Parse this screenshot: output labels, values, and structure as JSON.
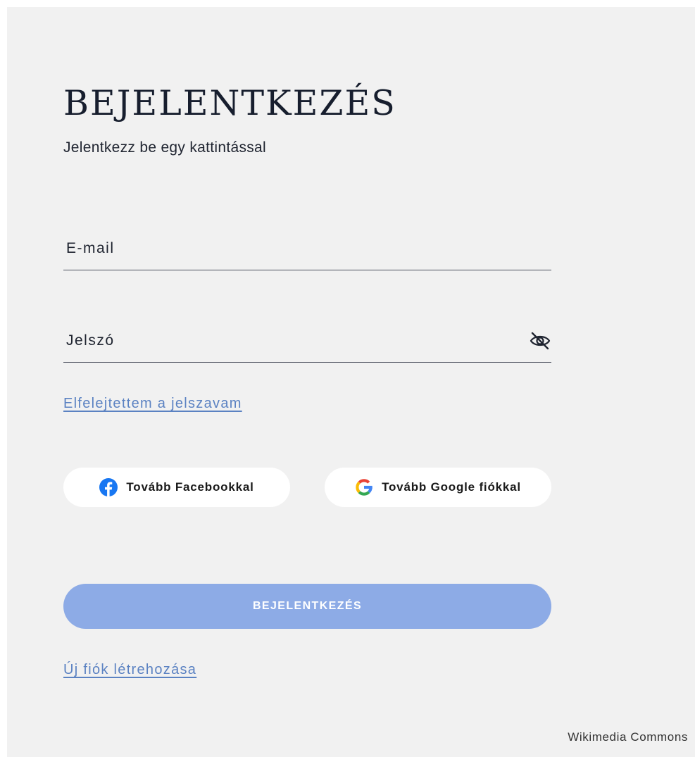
{
  "login": {
    "title": "BEJELENTKEZÉS",
    "subtitle": "Jelentkezz be egy kattintással",
    "email_placeholder": "E-mail",
    "password_placeholder": "Jelszó",
    "forgot_link": "Elfelejtettem a jelszavam",
    "facebook_label": "Tovább Facebookkal",
    "google_label": "Tovább Google fiókkal",
    "submit_label": "BEJELENTKEZÉS",
    "signup_link": "Új fiók létrehozása"
  },
  "icons": {
    "password_toggle": "eye-off-icon",
    "facebook": "facebook-icon",
    "google": "google-icon"
  },
  "colors": {
    "background": "#f1f1f1",
    "title": "#171e2e",
    "link": "#5b82c2",
    "submit_button": "#8dabe6",
    "facebook": "#1877f2"
  },
  "footer": {
    "credit": "Wikimedia Commons"
  }
}
